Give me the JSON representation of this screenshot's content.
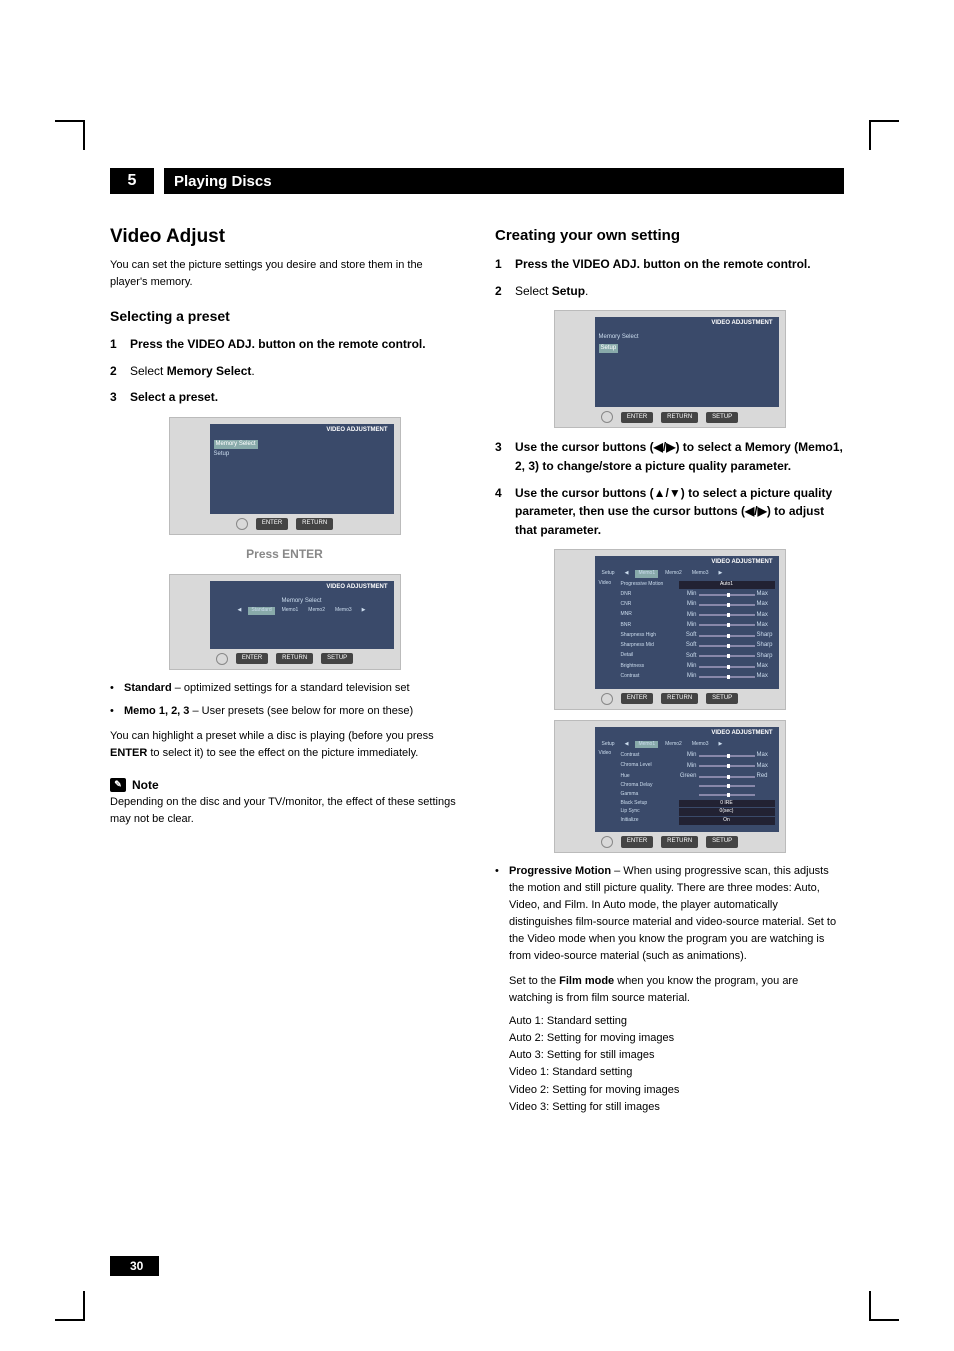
{
  "chapter": {
    "number": "5",
    "title": "Playing Discs"
  },
  "page_number": "30",
  "left": {
    "h2": "Video Adjust",
    "intro": "You can set the picture settings you desire and store them in the player's memory.",
    "h3": "Selecting a preset",
    "steps": [
      {
        "n": "1",
        "t": "Press the VIDEO ADJ. button on the remote control."
      },
      {
        "n": "2",
        "pre": "Select ",
        "bold": "Memory Select",
        "post": "."
      },
      {
        "n": "3",
        "t": "Select a preset."
      }
    ],
    "osd1": {
      "title": "VIDEO ADJUSTMENT",
      "row1": "Memory Select",
      "row2": "Setup",
      "buttons": [
        "ENTER",
        "RETURN"
      ]
    },
    "press": "Press ENTER",
    "osd2": {
      "title": "VIDEO ADJUSTMENT",
      "row1": "Memory Select",
      "tabs": [
        "Standard",
        "Memo1",
        "Memo2",
        "Memo3"
      ],
      "buttons": [
        "ENTER",
        "RETURN",
        "SETUP"
      ]
    },
    "bullets": [
      {
        "b": "Standard",
        "t": " – optimized settings for a standard television set"
      },
      {
        "b": "Memo 1, 2, 3",
        "t": " – User presets (see below for more on these)"
      }
    ],
    "after_bullets": "You can highlight a preset while a disc is playing (before you press ENTER to select it) to see the effect on the picture immediately.",
    "note_label": "Note",
    "note_body": "Depending on the disc and your TV/monitor, the effect of these settings may not be clear."
  },
  "right": {
    "h3": "Creating your own setting",
    "steps": [
      {
        "n": "1",
        "t": "Press the VIDEO ADJ. button on the remote control."
      },
      {
        "n": "2",
        "pre": "Select ",
        "bold": "Setup",
        "post": "."
      }
    ],
    "osd1": {
      "title": "VIDEO ADJUSTMENT",
      "row1": "Memory Select",
      "row2": "Setup",
      "buttons": [
        "ENTER",
        "RETURN",
        "SETUP"
      ]
    },
    "steps2": [
      {
        "n": "3",
        "t": "Use the cursor buttons (◀/▶) to select a Memory (Memo1, 2, 3) to change/store a picture quality parameter."
      },
      {
        "n": "4",
        "t": "Use the cursor buttons (▲/▼) to select a picture quality parameter, then use the cursor buttons (◀/▶) to adjust that parameter."
      }
    ],
    "osd2": {
      "title": "VIDEO ADJUSTMENT",
      "top_tabs": [
        "Setup",
        "Memo1",
        "Memo2",
        "Memo3"
      ],
      "side": "Video",
      "params": [
        {
          "name": "Progressive Motion",
          "val": "Auto1"
        },
        {
          "name": "DNR",
          "l": "Min",
          "r": "Max"
        },
        {
          "name": "CNR",
          "l": "Min",
          "r": "Max"
        },
        {
          "name": "MNR",
          "l": "Min",
          "r": "Max"
        },
        {
          "name": "BNR",
          "l": "Min",
          "r": "Max"
        },
        {
          "name": "Sharpness High",
          "l": "Soft",
          "r": "Sharp"
        },
        {
          "name": "Sharpness Mid",
          "l": "Soft",
          "r": "Sharp"
        },
        {
          "name": "Detail",
          "l": "Soft",
          "r": "Sharp"
        },
        {
          "name": "Brightness",
          "l": "Min",
          "r": "Max"
        },
        {
          "name": "Contrast",
          "l": "Min",
          "r": "Max"
        }
      ],
      "buttons": [
        "ENTER",
        "RETURN",
        "SETUP"
      ]
    },
    "osd3": {
      "title": "VIDEO ADJUSTMENT",
      "top_tabs": [
        "Setup",
        "Memo1",
        "Memo2",
        "Memo3"
      ],
      "side": "Video",
      "params": [
        {
          "name": "Contrast",
          "l": "Min",
          "r": "Max"
        },
        {
          "name": "Chroma Level",
          "l": "Min",
          "r": "Max"
        },
        {
          "name": "Hue",
          "l": "Green",
          "r": "Red"
        },
        {
          "name": "Chroma Delay",
          "l": "",
          "r": ""
        },
        {
          "name": "Gamma",
          "l": "",
          "r": ""
        },
        {
          "name": "Black Setup",
          "val": "0 IRE"
        },
        {
          "name": "Lip Sync",
          "val": "0(sec)"
        },
        {
          "name": "Initialize",
          "val": "On"
        }
      ],
      "buttons": [
        "ENTER",
        "RETURN",
        "SETUP"
      ]
    },
    "pm_bullet_bold": "Progressive Motion",
    "pm_bullet": " – When using progressive scan, this adjusts the motion and still picture quality. There are three modes: Auto, Video, and Film. In Auto mode, the player automatically distinguishes film-source material and video-source material. Set to the Video mode when you know the program you are watching is from video-source material (such as animations).",
    "film_line_pre": "Set to the ",
    "film_line_bold": "Film mode",
    "film_line_post": " when you know the program, you are watching is from film source material.",
    "modes": [
      "Auto 1: Standard setting",
      "Auto 2: Setting for moving images",
      "Auto 3: Setting for still images",
      "Video 1: Standard setting",
      "Video 2: Setting for moving images",
      "Video 3: Setting for still images"
    ]
  }
}
